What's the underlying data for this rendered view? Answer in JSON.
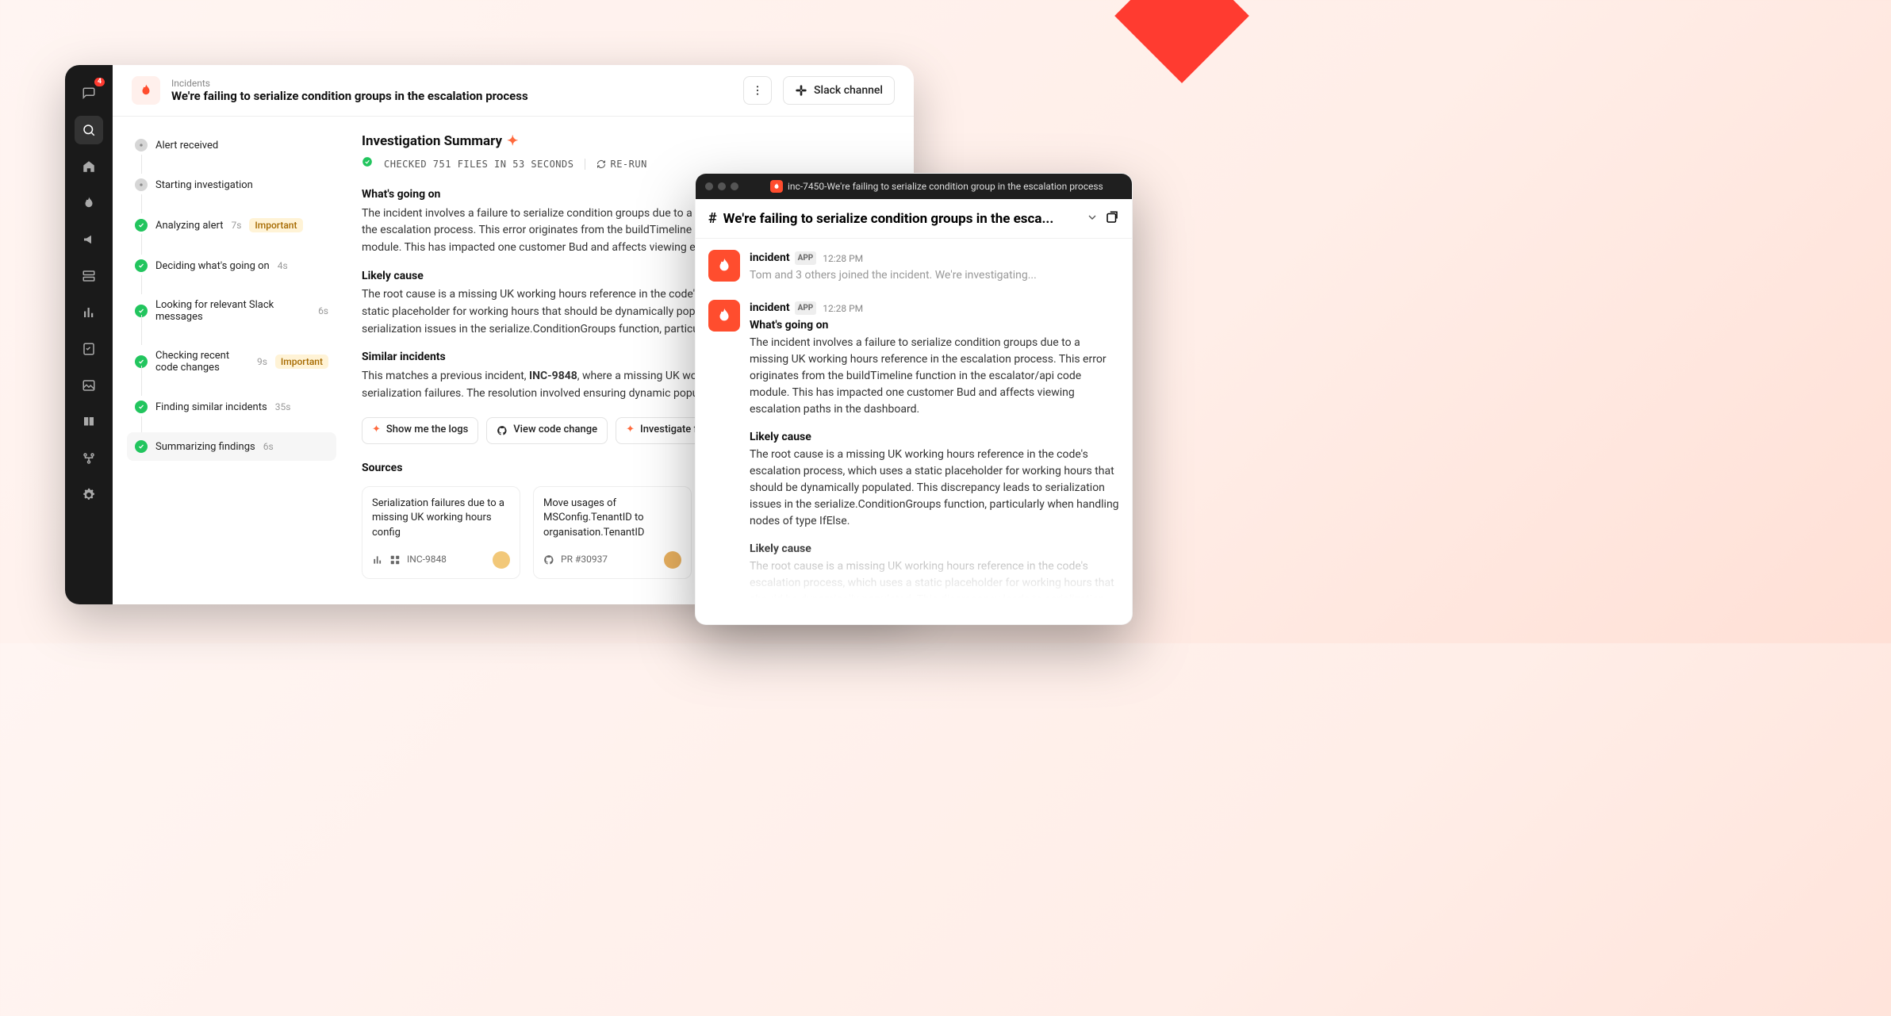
{
  "sidebar": {
    "badge": "4"
  },
  "header": {
    "breadcrumb": "Incidents",
    "title": "We're failing to serialize condition groups in the escalation process",
    "slackButton": "Slack channel"
  },
  "timeline": [
    {
      "status": "grey",
      "label": "Alert received",
      "time": "",
      "badge": ""
    },
    {
      "status": "grey",
      "label": "Starting investigation",
      "time": "",
      "badge": ""
    },
    {
      "status": "green",
      "label": "Analyzing alert",
      "time": "7s",
      "badge": "Important"
    },
    {
      "status": "green",
      "label": "Deciding what's going on",
      "time": "4s",
      "badge": ""
    },
    {
      "status": "green",
      "label": "Looking for relevant Slack messages",
      "time": "6s",
      "badge": ""
    },
    {
      "status": "green",
      "label": "Checking recent code changes",
      "time": "9s",
      "badge": "Important"
    },
    {
      "status": "green",
      "label": "Finding similar incidents",
      "time": "35s",
      "badge": ""
    },
    {
      "status": "green",
      "label": "Summarizing findings",
      "time": "6s",
      "badge": "",
      "highlight": true
    }
  ],
  "summary": {
    "title": "Investigation Summary",
    "checked": "CHECKED 751 FILES IN 53 SECONDS",
    "rerun": "RE-RUN",
    "h_whats": "What's going on",
    "p_whats": "The incident involves a failure to serialize condition groups due to a missing UK working hours reference in the escalation process. This error originates from the buildTimeline function in the escalator/api code module. This has impacted one customer Bud and affects viewing escalation paths.",
    "h_cause": "Likely cause",
    "p_cause": "The root cause is a missing UK working hours reference in the code's escalation process, which uses a static placeholder for working hours that should be dynamically populated. This discrepancy leads to serialization issues in the serialize.ConditionGroups function, particularly when handling nodes.",
    "h_similar": "Similar incidents",
    "p_similar_pre": "This matches a previous incident, ",
    "p_similar_id": "INC-9848",
    "p_similar_post": ", where a missing UK working hours reference leads to serialization failures. The resolution involved ensuring dynamic population.",
    "actions": {
      "logs": "Show me the logs",
      "code": "View code change",
      "investigate": "Investigate further"
    },
    "sourcesTitle": "Sources",
    "sources": [
      {
        "title": "Serialization failures due to a missing UK working hours config",
        "ref": "INC-9848"
      },
      {
        "title": "Move usages of MSConfig.TenantID to organisation.TenantID",
        "ref": "PR #30937"
      }
    ]
  },
  "slack": {
    "windowTitle": "inc-7450-We're failing to serialize condition group in the escalation process",
    "channel": "We're failing to serialize condition groups in the esca...",
    "messages": [
      {
        "sender": "incident",
        "app": "APP",
        "time": "12:28 PM",
        "body": "Tom and 3 others joined the incident. We're investigating...",
        "muted": true
      },
      {
        "sender": "incident",
        "app": "APP",
        "time": "12:28 PM",
        "h1": "What's going on",
        "p1": "The incident involves a failure to serialize condition groups due to a missing UK working hours reference in the escalation process. This error originates from the buildTimeline function in the escalator/api code module. This has impacted one customer Bud and affects viewing escalation paths in the dashboard.",
        "h2": "Likely cause",
        "p2": "The root cause is a missing UK working hours reference in the code's escalation process, which uses a static placeholder for working hours that should be dynamically populated. This discrepancy leads to serialization issues in the serialize.ConditionGroups function, particularly when handling nodes of type IfElse.",
        "h3": "Likely cause",
        "p3": "The root cause is a missing UK working hours reference in the code's escalation process, which uses a static placeholder for working hours that should be dynamically populated. This discrepancy leads to serialization issues in the serialize.ConditionGroups function, particularly when handling nodes of type IfElse."
      }
    ]
  }
}
